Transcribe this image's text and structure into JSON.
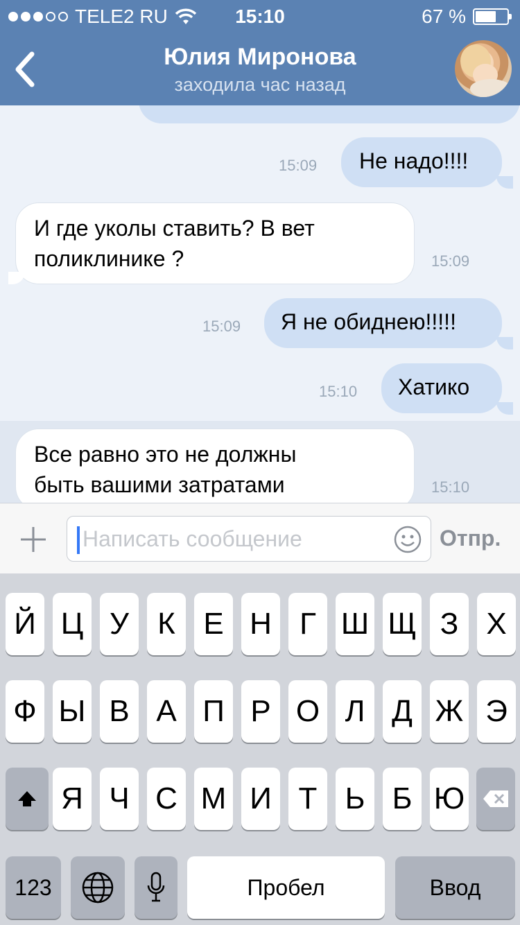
{
  "status_bar": {
    "carrier": "TELE2 RU",
    "time": "15:10",
    "battery_text": "67 %",
    "battery_level": 0.67
  },
  "header": {
    "title": "Юлия Миронова",
    "subtitle": "заходила час назад"
  },
  "messages": [
    {
      "direction": "out",
      "text": "Не надо!!!!",
      "time": "15:09"
    },
    {
      "direction": "in",
      "lines": [
        "И где уколы ставить? В вет",
        "поликлинике ?"
      ],
      "time": "15:09"
    },
    {
      "direction": "out",
      "text": "Я не обиднею!!!!!",
      "time": "15:09"
    },
    {
      "direction": "out",
      "text": "Хатико",
      "time": "15:10"
    },
    {
      "direction": "in",
      "lines": [
        "Все равно это не должны",
        "быть вашими затратами"
      ],
      "time": "15:10"
    }
  ],
  "composer": {
    "placeholder": "Написать сообщение",
    "send_label": "Отпр."
  },
  "keyboard": {
    "row1": [
      "Й",
      "Ц",
      "У",
      "К",
      "Е",
      "Н",
      "Г",
      "Ш",
      "Щ",
      "З",
      "Х"
    ],
    "row2": [
      "Ф",
      "Ы",
      "В",
      "А",
      "П",
      "Р",
      "О",
      "Л",
      "Д",
      "Ж",
      "Э"
    ],
    "row3": [
      "Я",
      "Ч",
      "С",
      "М",
      "И",
      "Т",
      "Ь",
      "Б",
      "Ю"
    ],
    "numbers_label": "123",
    "space_label": "Пробел",
    "return_label": "Ввод"
  },
  "colors": {
    "header_bg": "#5b82b3",
    "outgoing_bubble": "#cfdff4",
    "incoming_bubble": "#ffffff",
    "chat_bg": "#edf2f9"
  }
}
